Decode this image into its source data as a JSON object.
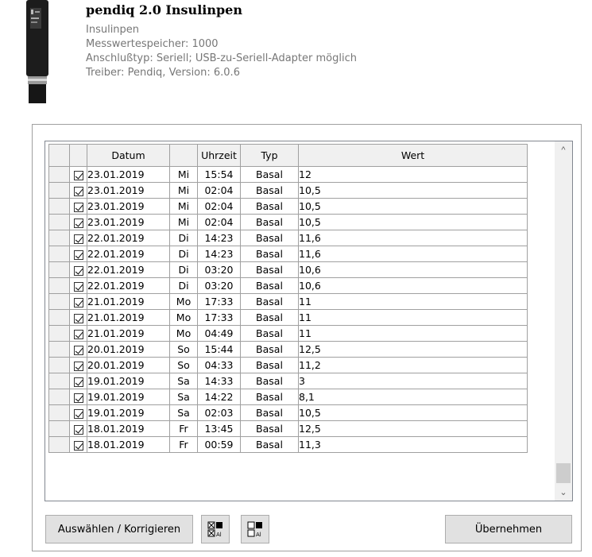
{
  "device": {
    "title": "pendiq 2.0 Insulinpen",
    "lines": [
      "Insulinpen",
      "Messwertespeicher: 1000",
      "Anschlußtyp: Seriell; USB-zu-Seriell-Adapter möglich",
      "Treiber: Pendiq, Version: 6.0.6"
    ],
    "image_icon": "insulin-pen-device"
  },
  "grid": {
    "columns": [
      "",
      "",
      "Datum",
      "",
      "Uhrzeit",
      "Typ",
      "Wert"
    ],
    "rows": [
      {
        "checked": true,
        "date": "23.01.2019",
        "day": "Mi",
        "time": "15:54",
        "type": "Basal",
        "value": "12"
      },
      {
        "checked": true,
        "date": "23.01.2019",
        "day": "Mi",
        "time": "02:04",
        "type": "Basal",
        "value": "10,5"
      },
      {
        "checked": true,
        "date": "23.01.2019",
        "day": "Mi",
        "time": "02:04",
        "type": "Basal",
        "value": "10,5"
      },
      {
        "checked": true,
        "date": "23.01.2019",
        "day": "Mi",
        "time": "02:04",
        "type": "Basal",
        "value": "10,5"
      },
      {
        "checked": true,
        "date": "22.01.2019",
        "day": "Di",
        "time": "14:23",
        "type": "Basal",
        "value": "11,6"
      },
      {
        "checked": true,
        "date": "22.01.2019",
        "day": "Di",
        "time": "14:23",
        "type": "Basal",
        "value": "11,6"
      },
      {
        "checked": true,
        "date": "22.01.2019",
        "day": "Di",
        "time": "03:20",
        "type": "Basal",
        "value": "10,6"
      },
      {
        "checked": true,
        "date": "22.01.2019",
        "day": "Di",
        "time": "03:20",
        "type": "Basal",
        "value": "10,6"
      },
      {
        "checked": true,
        "date": "21.01.2019",
        "day": "Mo",
        "time": "17:33",
        "type": "Basal",
        "value": "11"
      },
      {
        "checked": true,
        "date": "21.01.2019",
        "day": "Mo",
        "time": "17:33",
        "type": "Basal",
        "value": "11"
      },
      {
        "checked": true,
        "date": "21.01.2019",
        "day": "Mo",
        "time": "04:49",
        "type": "Basal",
        "value": "11"
      },
      {
        "checked": true,
        "date": "20.01.2019",
        "day": "So",
        "time": "15:44",
        "type": "Basal",
        "value": "12,5"
      },
      {
        "checked": true,
        "date": "20.01.2019",
        "day": "So",
        "time": "04:33",
        "type": "Basal",
        "value": "11,2"
      },
      {
        "checked": true,
        "date": "19.01.2019",
        "day": "Sa",
        "time": "14:33",
        "type": "Basal",
        "value": "3"
      },
      {
        "checked": true,
        "date": "19.01.2019",
        "day": "Sa",
        "time": "14:22",
        "type": "Basal",
        "value": "8,1"
      },
      {
        "checked": true,
        "date": "19.01.2019",
        "day": "Sa",
        "time": "02:03",
        "type": "Basal",
        "value": "10,5"
      },
      {
        "checked": true,
        "date": "18.01.2019",
        "day": "Fr",
        "time": "13:45",
        "type": "Basal",
        "value": "12,5"
      },
      {
        "checked": true,
        "date": "18.01.2019",
        "day": "Fr",
        "time": "00:59",
        "type": "Basal",
        "value": "11,3"
      }
    ]
  },
  "scrollbar": {
    "up_icon": "chevron-up-icon",
    "down_icon": "chevron-down-icon",
    "up_glyph": "^",
    "down_glyph": "⌄"
  },
  "buttons": {
    "select_label": "Auswählen / Korrigieren",
    "icon1": "select-all-icon",
    "icon2": "deselect-all-icon",
    "apply_label": "Übernehmen"
  }
}
